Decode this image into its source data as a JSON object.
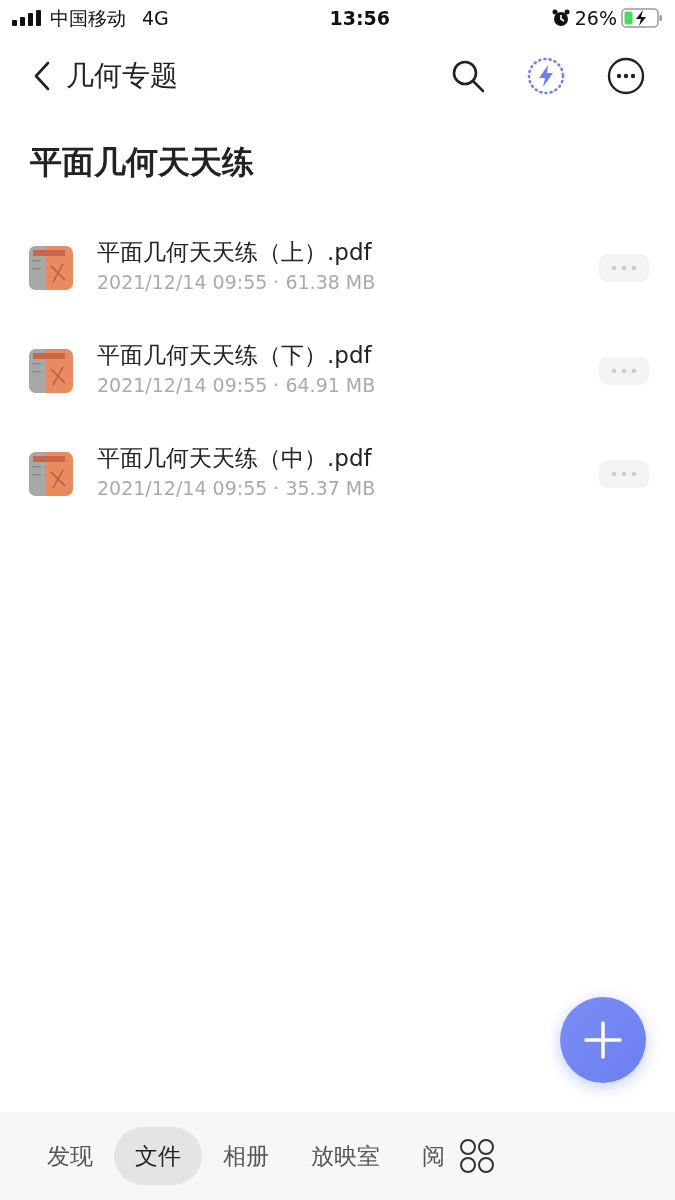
{
  "status_bar": {
    "carrier": "中国移动",
    "network": "4G",
    "time": "13:56",
    "battery_percent": "26%",
    "battery": {
      "level": 0.26,
      "charging": true
    }
  },
  "nav": {
    "title": "几何专题"
  },
  "heading": "平面几何天天练",
  "files": [
    {
      "name": "平面几何天天练（上）.pdf",
      "meta": "2021/12/14 09:55 · 61.38 MB",
      "kind": "picture"
    },
    {
      "name": "平面几何天天练（下）.pdf",
      "meta": "2021/12/14 09:55 · 64.91 MB",
      "kind": "picture"
    },
    {
      "name": "平面几何天天练（中）.pdf",
      "meta": "2021/12/14 09:55 · 35.37 MB",
      "kind": "picture"
    }
  ],
  "tabs": [
    {
      "label": "发现",
      "selected": false
    },
    {
      "label": "文件",
      "selected": true
    },
    {
      "label": "相册",
      "selected": false
    },
    {
      "label": "放映室",
      "selected": false
    },
    {
      "label": "阅",
      "selected": false
    }
  ]
}
